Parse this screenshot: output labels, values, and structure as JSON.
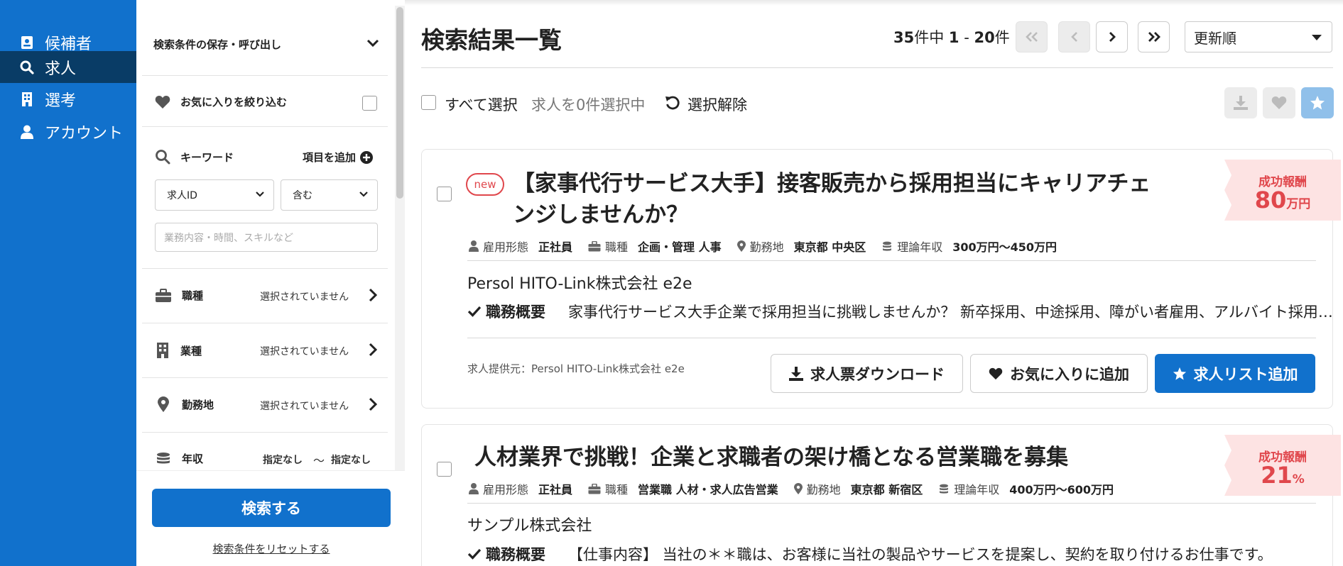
{
  "nav": {
    "items": [
      {
        "label": "候補者",
        "icon": "id-card-icon"
      },
      {
        "label": "求人",
        "icon": "search-icon"
      },
      {
        "label": "選考",
        "icon": "building-icon"
      },
      {
        "label": "アカウント",
        "icon": "user-icon"
      }
    ],
    "active_index": 1
  },
  "filters": {
    "saved_conditions": "検索条件の保存・呼び出し",
    "favorites_only": "お気に入りを絞り込む",
    "keyword": {
      "label": "キーワード",
      "add_item": "項目を追加",
      "field_select": "求人ID",
      "operator_select": "含む",
      "input_placeholder": "業務内容・時間、スキルなど"
    },
    "job_type": {
      "label": "職種",
      "value": "選択されていません"
    },
    "industry": {
      "label": "業種",
      "value": "選択されていません"
    },
    "location": {
      "label": "勤務地",
      "value": "選択されていません"
    },
    "salary": {
      "label": "年収",
      "min": "指定なし",
      "sep": "〜",
      "max": "指定なし"
    },
    "search_button": "検索する",
    "reset_link": "検索条件をリセットする"
  },
  "results": {
    "title": "検索結果一覧",
    "count_total": "35",
    "count_mid": "件中",
    "count_start": "1",
    "count_dash": " - ",
    "count_end": "20",
    "count_suffix": "件",
    "sort": "更新順",
    "select_all": "すべて選択",
    "selected_count": "求人を0件選択中",
    "clear_selection": "選択解除"
  },
  "jobs": [
    {
      "is_new": true,
      "new_label": "new",
      "title_line1": "【家事代行サービス大手】接客販売から採用担当にキャリアチェ",
      "title_line2": "ンジしませんか？",
      "meta": {
        "employment_label": "雇用形態",
        "employment": "正社員",
        "job_type_label": "職種",
        "job_type": "企画・管理 人事",
        "location_label": "勤務地",
        "location": "東京都 中央区",
        "salary_label": "理論年収",
        "salary": "300万円〜450万円"
      },
      "company": "Persol HITO-Link株式会社 e2e",
      "summary_label": "職務概要",
      "summary": "家事代行サービス大手企業で採用担当に挑戦しませんか？ 新卒採用、中途採用、障がい者雇用、アルバイト採用など幅広くお任せします。",
      "provider": "求人提供元：Persol HITO-Link株式会社 e2e",
      "download_label": "求人票ダウンロード",
      "favorite_label": "お気に入りに追加",
      "add_list_label": "求人リスト追加",
      "reward_label": "成功報酬",
      "reward_value": "80",
      "reward_unit": "万円"
    },
    {
      "is_new": false,
      "title_line1": "人材業界で挑戦！企業と求職者の架け橋となる営業職を募集",
      "meta": {
        "employment_label": "雇用形態",
        "employment": "正社員",
        "job_type_label": "職種",
        "job_type": "営業職 人材・求人広告営業",
        "location_label": "勤務地",
        "location": "東京都 新宿区",
        "salary_label": "理論年収",
        "salary": "400万円〜600万円"
      },
      "company": "サンプル株式会社",
      "summary_label": "職務概要",
      "summary": "【仕事内容】 当社の＊＊職は、お客様に当社の製品やサービスを提案し、契約を取り付けるお仕事です。",
      "reward_label": "成功報酬",
      "reward_value": "21",
      "reward_unit": "%"
    }
  ],
  "colors": {
    "brand": "#1171cc",
    "nav_active": "#093c66",
    "reward": "#e0474c",
    "reward_bg": "#fde3e3"
  }
}
